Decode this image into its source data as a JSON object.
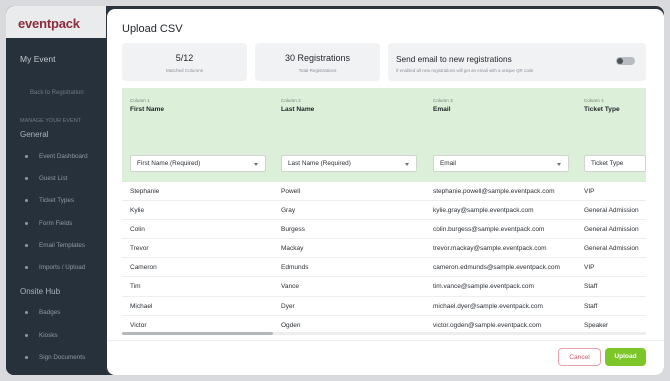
{
  "sidebar": {
    "logo": "eventpack",
    "event_title": "My Event",
    "back_link": "Back to Registration",
    "manage_label": "MANAGE YOUR EVENT",
    "general_label": "General",
    "general_items": [
      "Event Dashboard",
      "Guest List",
      "Ticket Types",
      "Form Fields",
      "Email Templates",
      "Imports / Upload"
    ],
    "onsite_label": "Onsite Hub",
    "onsite_items": [
      "Badges",
      "Kiosks",
      "Sign Documents"
    ]
  },
  "modal": {
    "title": "Upload CSV",
    "stats": [
      {
        "value": "5/12",
        "label": "Matched Columns"
      },
      {
        "value": "30 Registrations",
        "label": "Total Registrations"
      }
    ],
    "email_toggle": {
      "title": "Send email to new registrations",
      "description": "If enabled all new registrations will get an email with a unique QR code",
      "enabled": false
    },
    "columns": [
      {
        "number": "Column 1",
        "name": "First Name",
        "mapping": "First Name (Required)"
      },
      {
        "number": "Column 2",
        "name": "Last Name",
        "mapping": "Last Name (Required)"
      },
      {
        "number": "Column 3",
        "name": "Email",
        "mapping": "Email"
      },
      {
        "number": "Column 4",
        "name": "Ticket Type",
        "mapping": "Ticket Type"
      }
    ],
    "rows": [
      [
        "Stephanie",
        "Powell",
        "stephanie.powell@sample.eventpack.com",
        "VIP"
      ],
      [
        "Kylie",
        "Gray",
        "kylie.gray@sample.eventpack.com",
        "General Admission"
      ],
      [
        "Colin",
        "Burgess",
        "colin.burgess@sample.eventpack.com",
        "General Admission"
      ],
      [
        "Trevor",
        "Mackay",
        "trevor.mackay@sample.eventpack.com",
        "General Admission"
      ],
      [
        "Cameron",
        "Edmunds",
        "cameron.edmunds@sample.eventpack.com",
        "VIP"
      ],
      [
        "Tim",
        "Vance",
        "tim.vance@sample.eventpack.com",
        "Staff"
      ],
      [
        "Michael",
        "Dyer",
        "michael.dyer@sample.eventpack.com",
        "Staff"
      ],
      [
        "Victor",
        "Ogden",
        "victor.ogden@sample.eventpack.com",
        "Speaker"
      ]
    ],
    "cancel_label": "Cancel",
    "upload_label": "Upload"
  },
  "colors": {
    "accent_green": "#7cc62a",
    "mapping_header_bg": "#dcf0d9",
    "cancel_red": "#d15a6a",
    "sidebar_bg": "#27313b"
  }
}
